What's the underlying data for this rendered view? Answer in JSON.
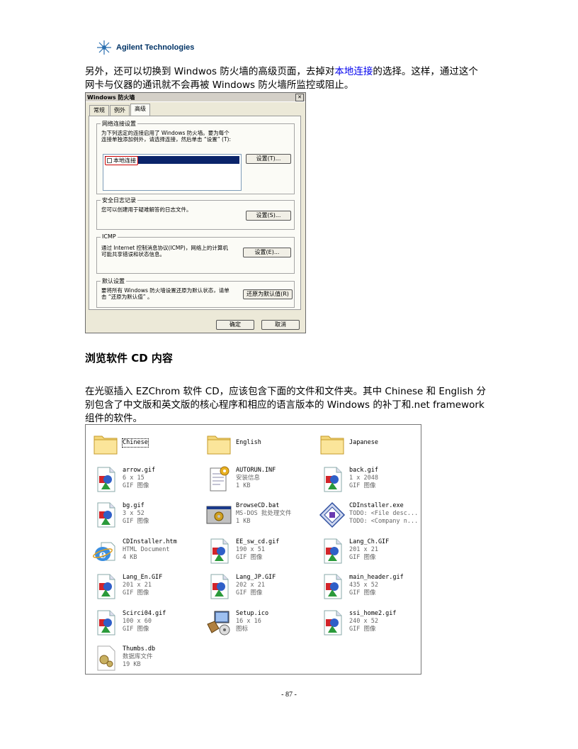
{
  "header": {
    "brand": "Agilent Technologies"
  },
  "intro": {
    "line1_a": "另外，还可以切换到 Windwos 防火墙的高级页面，去掉对",
    "line1_link": "本地连接",
    "line1_b": "的选择。这样，通过这个",
    "line2": "网卡与仪器的通讯就不会再被 Windows 防火墙所监控或阻止。"
  },
  "dialog": {
    "title": "Windows 防火墙",
    "tabs": [
      "常规",
      "例外",
      "高级"
    ],
    "active_tab": "高级",
    "network": {
      "legend": "网络连接设置",
      "desc": "为下列选定的连接启用了 Windows 防火墙。要为每个连接单独添加例外，请选择连接，然后单击 “设置” (T):",
      "item": "本地连接",
      "button": "设置(T)..."
    },
    "log": {
      "legend": "安全日志记录",
      "desc": "您可以创建用于疑难解答的日志文件。",
      "button": "设置(S)..."
    },
    "icmp": {
      "legend": "ICMP",
      "desc": "通过 Internet 控制消息协议(ICMP)，网络上的计算机可能共享错误和状态信息。",
      "button": "设置(E)..."
    },
    "defaults": {
      "legend": "默认设置",
      "desc": "要将所有 Windows 防火墙设置还原为默认状态，请单击 “还原为默认值” 。",
      "button": "还原为默认值(R)"
    },
    "ok": "确定",
    "cancel": "取消"
  },
  "section": {
    "heading": "浏览软件 CD 内容",
    "p1": "在光驱插入 EZChrom 软件 CD，应该包含下面的文件和文件夹。其中 Chinese 和 English 分",
    "p2": "别包含了中文版和英文版的核心程序和相应的语言版本的 Windows 的补丁和.net framework",
    "p3": "组件的软件。"
  },
  "files": [
    {
      "name": "Chinese",
      "l2": "",
      "l3": "",
      "icon": "folder-icon"
    },
    {
      "name": "English",
      "l2": "",
      "l3": "",
      "icon": "folder-icon"
    },
    {
      "name": "Japanese",
      "l2": "",
      "l3": "",
      "icon": "folder-icon"
    },
    {
      "name": "arrow.gif",
      "l2": "6 x 15",
      "l3": "GIF 图像",
      "icon": "gif-image-icon"
    },
    {
      "name": "AUTORUN.INF",
      "l2": "安装信息",
      "l3": "1 KB",
      "icon": "setup-info-icon"
    },
    {
      "name": "back.gif",
      "l2": "1 x 2048",
      "l3": "GIF 图像",
      "icon": "gif-image-icon"
    },
    {
      "name": "bg.gif",
      "l2": "3 x 52",
      "l3": "GIF 图像",
      "icon": "gif-image-icon"
    },
    {
      "name": "BrowseCD.bat",
      "l2": "MS-DOS 批处理文件",
      "l3": "1 KB",
      "icon": "batch-file-icon"
    },
    {
      "name": "CDInstaller.exe",
      "l2": "TODO: <File desc...",
      "l3": "TODO: <Company n...",
      "icon": "installer-exe-icon"
    },
    {
      "name": "CDInstaller.htm",
      "l2": "HTML Document",
      "l3": "4 KB",
      "icon": "ie-html-icon"
    },
    {
      "name": "EE_sw_cd.gif",
      "l2": "190 x 51",
      "l3": "GIF 图像",
      "icon": "gif-image-icon"
    },
    {
      "name": "Lang_Ch.GIF",
      "l2": "201 x 21",
      "l3": "GIF 图像",
      "icon": "gif-image-icon"
    },
    {
      "name": "Lang_En.GIF",
      "l2": "201 x 21",
      "l3": "GIF 图像",
      "icon": "gif-image-icon"
    },
    {
      "name": "Lang_JP.GIF",
      "l2": "202 x 21",
      "l3": "GIF 图像",
      "icon": "gif-image-icon"
    },
    {
      "name": "main_header.gif",
      "l2": "435 x 52",
      "l3": "GIF 图像",
      "icon": "gif-image-icon"
    },
    {
      "name": "Scirci04.gif",
      "l2": "100 x 60",
      "l3": "GIF 图像",
      "icon": "gif-image-icon"
    },
    {
      "name": "Setup.ico",
      "l2": "16 x 16",
      "l3": "图标",
      "icon": "setup-ico-icon"
    },
    {
      "name": "ssi_home2.gif",
      "l2": "240 x 52",
      "l3": "GIF 图像",
      "icon": "gif-image-icon"
    },
    {
      "name": "Thumbs.db",
      "l2": "数据库文件",
      "l3": "19 KB",
      "icon": "database-file-icon"
    }
  ],
  "page_number": "- 87 -"
}
